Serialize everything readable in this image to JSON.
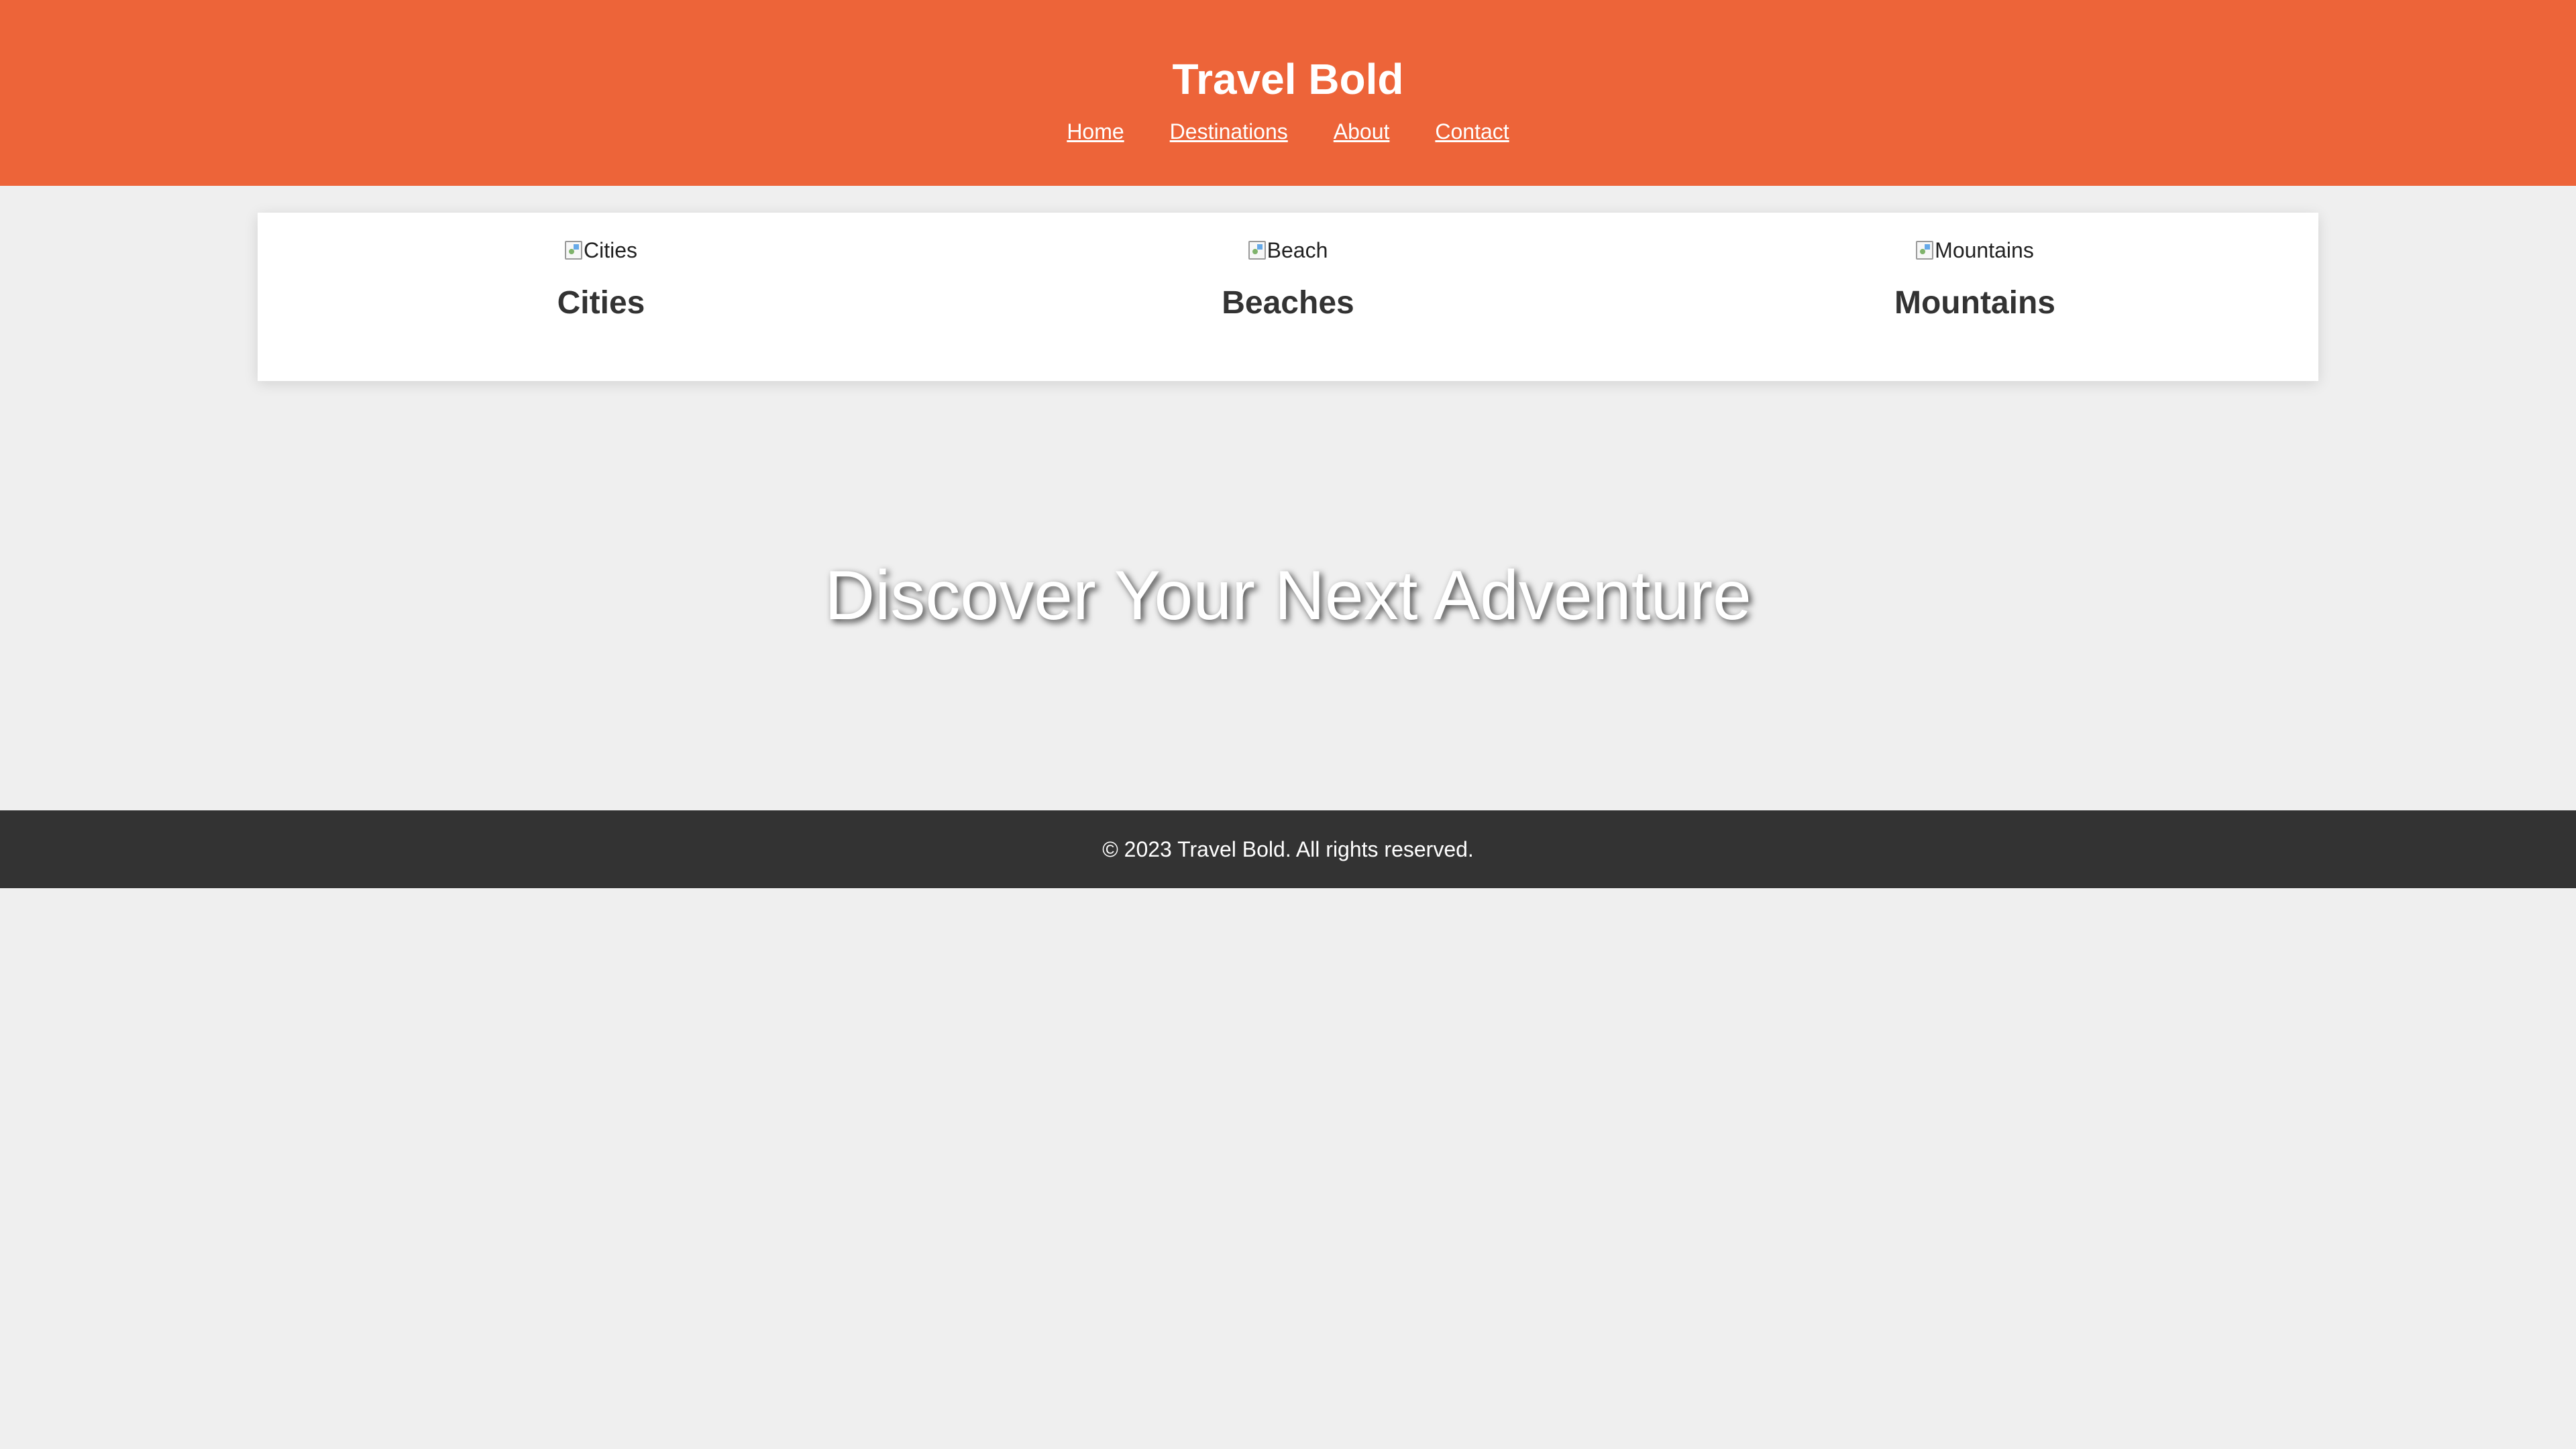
{
  "header": {
    "title": "Travel Bold",
    "nav": [
      "Home",
      "Destinations",
      "About",
      "Contact"
    ]
  },
  "categories": [
    {
      "image_alt": "Cities",
      "title": "Cities"
    },
    {
      "image_alt": "Beach",
      "title": "Beaches"
    },
    {
      "image_alt": "Mountains",
      "title": "Mountains"
    }
  ],
  "hero": {
    "title": "Discover Your Next Adventure"
  },
  "footer": {
    "text": "© 2023 Travel Bold. All rights reserved."
  },
  "colors": {
    "header_bg": "#ed6439",
    "page_bg": "#efefef",
    "footer_bg": "#333333",
    "text": "#333333"
  }
}
